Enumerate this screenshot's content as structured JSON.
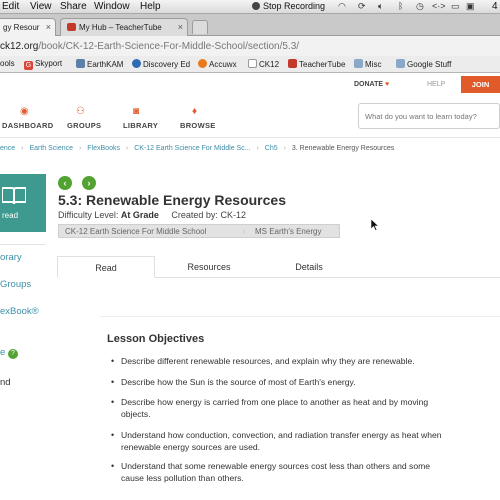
{
  "menubar": {
    "items": [
      "Edit",
      "View",
      "Share",
      "Window",
      "Help"
    ],
    "recording_label": "Stop Recording",
    "time_partial": "4"
  },
  "tabs": [
    {
      "label": "gy Resour",
      "active": true
    },
    {
      "label": "My Hub – TeacherTube",
      "active": false
    }
  ],
  "address": {
    "host": "ck12.org",
    "path": "/book/CK-12-Earth-Science-For-Middle-School/section/5.3/"
  },
  "bookmarks": [
    {
      "label": "ools",
      "icon": "folder-icon"
    },
    {
      "label": "Skyport",
      "icon": "g-icon"
    },
    {
      "label": "EarthKAM",
      "icon": "satellite-icon"
    },
    {
      "label": "Discovery Ed",
      "icon": "globe-icon"
    },
    {
      "label": "Accuwx",
      "icon": "weather-icon"
    },
    {
      "label": "CK12",
      "icon": "page-icon"
    },
    {
      "label": "TeacherTube",
      "icon": "teachertube-icon"
    },
    {
      "label": "Misc",
      "icon": "folder-icon"
    },
    {
      "label": "Google Stuff",
      "icon": "folder-icon"
    }
  ],
  "site_nav": {
    "donate": "DONATE",
    "help": "HELP",
    "join": "JOIN",
    "items": [
      "DASHBOARD",
      "GROUPS",
      "LIBRARY",
      "BROWSE"
    ],
    "search_placeholder": "What do you want to learn today?"
  },
  "breadcrumb": [
    "ence",
    "Earth Science",
    "FlexBooks",
    "CK-12 Earth Science For Middle Sc...",
    "Ch5",
    "3. Renewable Energy Resources"
  ],
  "sidebar": {
    "book_label": "read",
    "links": [
      "orary",
      "Groups",
      "exBook®",
      "e",
      "nd"
    ]
  },
  "lesson": {
    "title": "5.3: Renewable Energy Resources",
    "difficulty_label": "Difficulty Level:",
    "difficulty_value": "At Grade",
    "created_label": "Created by:",
    "created_value": "CK-12",
    "tags": [
      "CK-12 Earth Science For Middle School",
      "MS Earth's Energy"
    ]
  },
  "content_tabs": [
    "Read",
    "Resources",
    "Details"
  ],
  "objectives": {
    "heading": "Lesson Objectives",
    "items": [
      "Describe different renewable resources, and explain why they are renewable.",
      "Describe how the Sun is the source of most of Earth's energy.",
      "Describe how energy is carried from one place to another as heat and by moving objects.",
      "Understand how conduction, convection, and radiation transfer energy as heat when renewable energy sources are used.",
      "Understand that some renewable energy sources cost less than others and some cause less pollution than others."
    ]
  },
  "colors": {
    "brand_orange": "#e05a2a",
    "teal": "#3e9a8e",
    "link_blue": "#3d8fa8",
    "nav_green": "#52a332"
  }
}
